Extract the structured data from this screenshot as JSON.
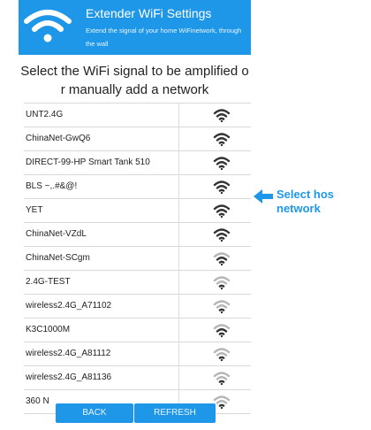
{
  "header": {
    "title": "Extender WiFi Settings",
    "subtitle": "Extend the signal of your home WiFinetwork, through the wall",
    "logo_icon": "wifi-logo-icon",
    "background_color": "#1f97e8"
  },
  "instruction": "Select the WiFi signal to be amplified o r manually add a network",
  "networks": [
    {
      "ssid": "UNT2.4G",
      "signal_icon": "wifi-signal-strong-icon"
    },
    {
      "ssid": "ChinaNet-GwQ6",
      "signal_icon": "wifi-signal-strong-icon"
    },
    {
      "ssid": "DIRECT-99-HP Smart Tank 510",
      "signal_icon": "wifi-signal-strong-icon"
    },
    {
      "ssid": "BLS ~,.#&@!",
      "signal_icon": "wifi-signal-strong-icon"
    },
    {
      "ssid": "YET",
      "signal_icon": "wifi-signal-strong-icon"
    },
    {
      "ssid": "ChinaNet-VZdL",
      "signal_icon": "wifi-signal-strong-icon"
    },
    {
      "ssid": "ChinaNet-SCgm",
      "signal_icon": "wifi-signal-medium-icon"
    },
    {
      "ssid": "2.4G-TEST",
      "signal_icon": "wifi-signal-weak-icon"
    },
    {
      "ssid": "wireless2.4G_A71102",
      "signal_icon": "wifi-signal-weak-icon"
    },
    {
      "ssid": "K3C1000M",
      "signal_icon": "wifi-signal-medium-icon"
    },
    {
      "ssid": "wireless2.4G_A81112",
      "signal_icon": "wifi-signal-weak-icon"
    },
    {
      "ssid": "wireless2.4G_A81136",
      "signal_icon": "wifi-signal-weak-icon"
    },
    {
      "ssid": "360 N",
      "signal_icon": "wifi-signal-weak-icon"
    }
  ],
  "buttons": {
    "back": "BACK",
    "refresh": "REFRESH"
  },
  "callout": {
    "line1": "Select hos",
    "line2": "network",
    "arrow_icon": "arrow-left-icon",
    "color": "#1f97e8"
  }
}
